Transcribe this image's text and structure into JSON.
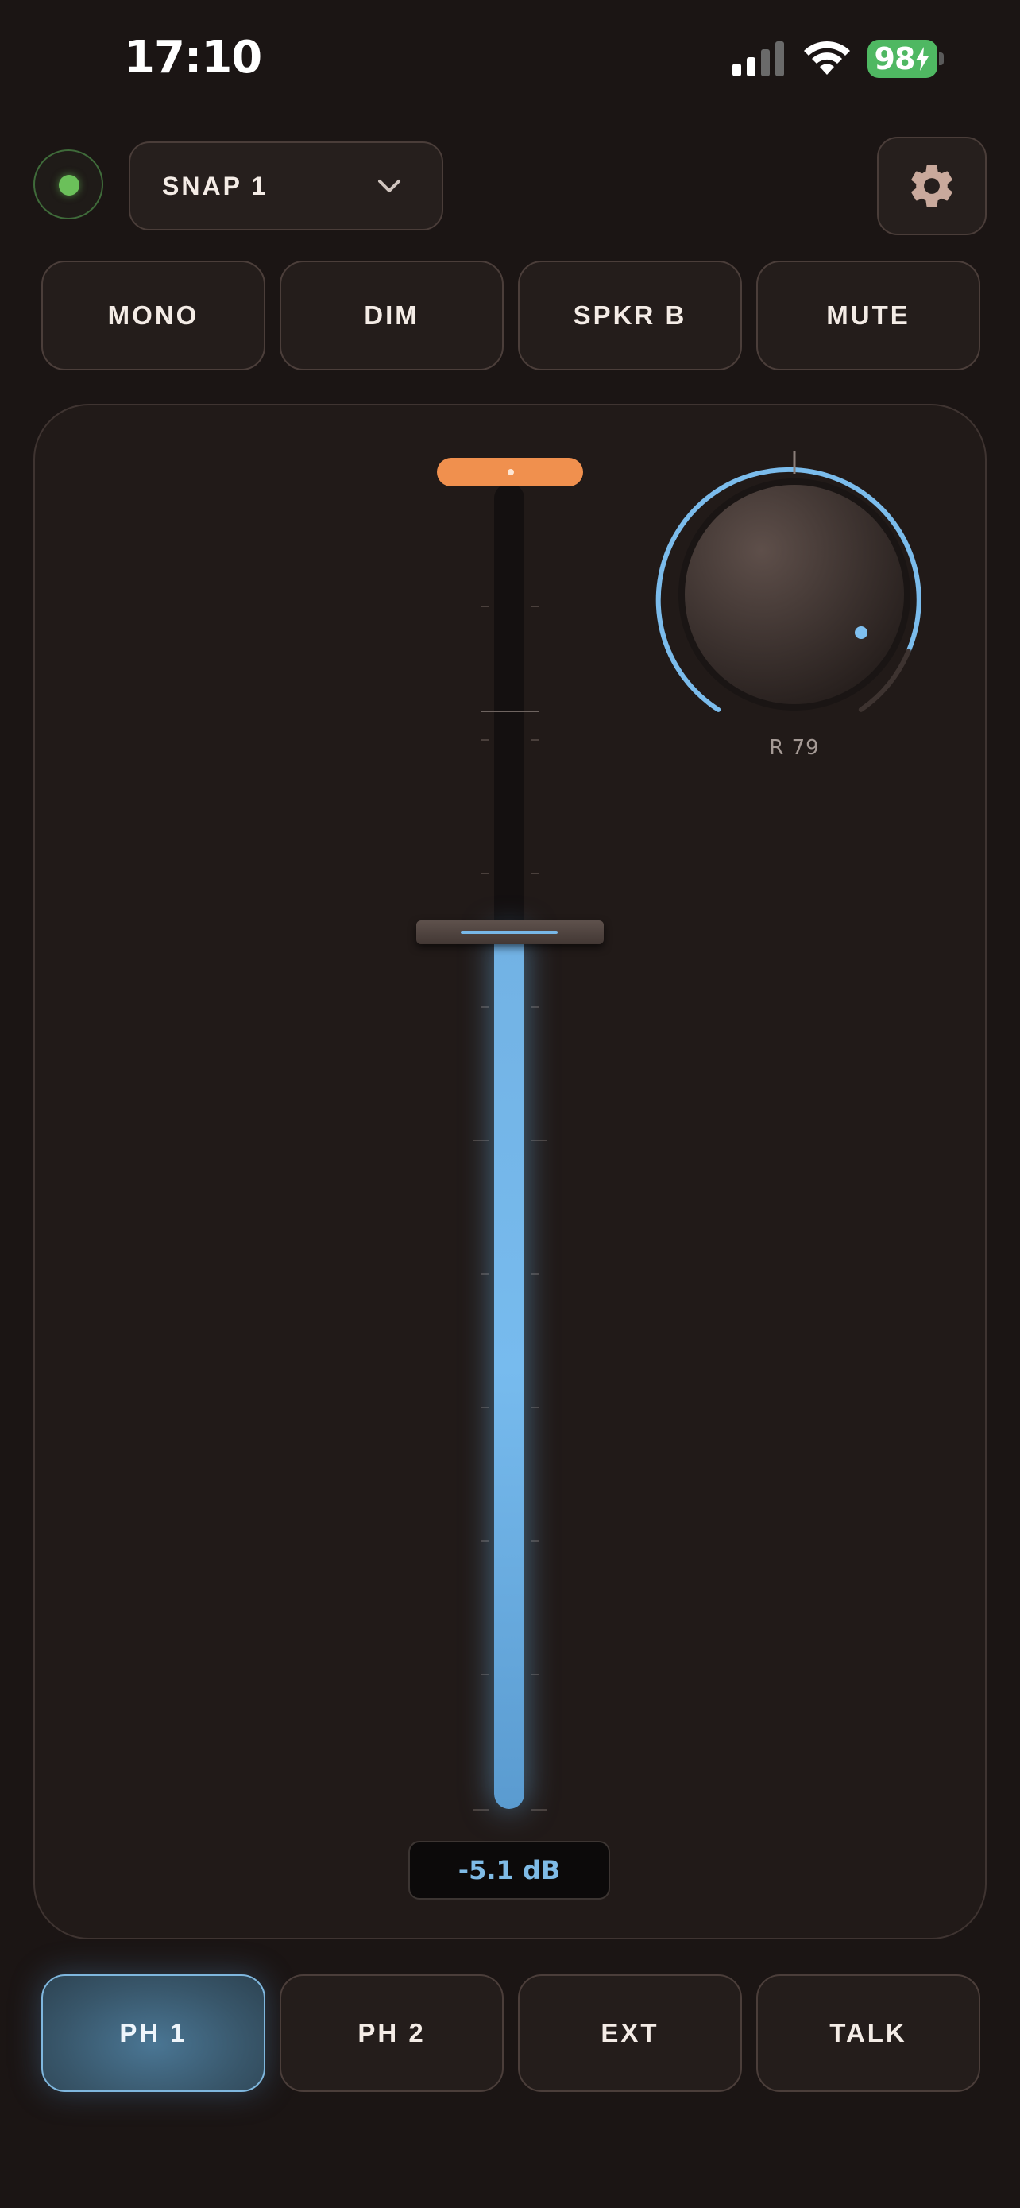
{
  "status_bar": {
    "time": "17:10",
    "battery_level": "98"
  },
  "header": {
    "snapshot_label": "SNAP 1"
  },
  "top_buttons": [
    {
      "label": "MONO"
    },
    {
      "label": "DIM"
    },
    {
      "label": "SPKR B"
    },
    {
      "label": "MUTE"
    }
  ],
  "fader": {
    "level_text": "-5.1 dB",
    "position_fraction": 0.67
  },
  "knob": {
    "label": "R 79",
    "value_percent": 79
  },
  "bottom_buttons": [
    {
      "label": "PH 1",
      "active": true
    },
    {
      "label": "PH 2",
      "active": false
    },
    {
      "label": "EXT",
      "active": false
    },
    {
      "label": "TALK",
      "active": false
    }
  ],
  "colors": {
    "accent": "#77bbee",
    "cap": "#f0904e",
    "led": "#6bc05a",
    "battery": "#4fb862"
  },
  "icons": [
    "signal-icon",
    "wifi-icon",
    "battery-icon",
    "chevron-down-icon",
    "gear-icon"
  ]
}
